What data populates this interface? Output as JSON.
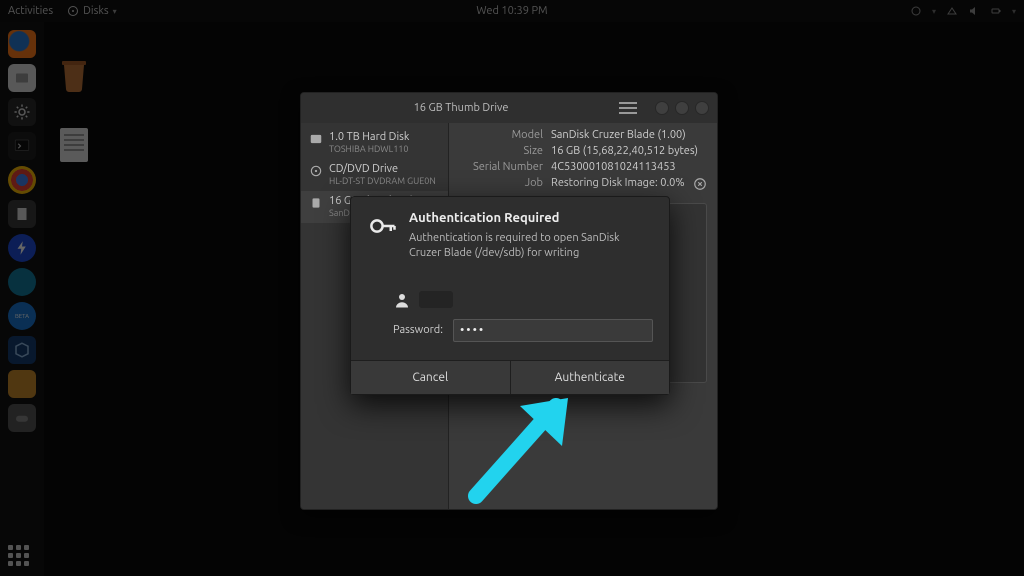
{
  "topbar": {
    "activities": "Activities",
    "app_name": "Disks",
    "clock": "Wed 10:39 PM"
  },
  "desktop": {
    "trash_label": "",
    "doc_label": ""
  },
  "disks_window": {
    "title": "16 GB Thumb Drive",
    "devices": [
      {
        "name": "1.0 TB Hard Disk",
        "sub": "TOSHIBA HDWL110"
      },
      {
        "name": "CD/DVD Drive",
        "sub": "HL-DT-ST DVDRAM GUE0N"
      },
      {
        "name": "16 GB Thumb Drive",
        "sub": "SanDisk Cruzer Blade"
      }
    ],
    "props": {
      "model_k": "Model",
      "model_v": "SanDisk Cruzer Blade (1.00)",
      "size_k": "Size",
      "size_v": "16 GB (15,68,22,40,512 bytes)",
      "serial_k": "Serial Number",
      "serial_v": "4C530001081024113453",
      "job_k": "Job",
      "job_v": "Restoring Disk Image: 0.0%"
    }
  },
  "auth": {
    "title": "Authentication Required",
    "message": "Authentication is required to open SanDisk Cruzer Blade (/dev/sdb) for writing",
    "password_label": "Password:",
    "password_value": "••••",
    "cancel": "Cancel",
    "authenticate": "Authenticate"
  },
  "colors": {
    "accent_arrow": "#22d3ee"
  }
}
